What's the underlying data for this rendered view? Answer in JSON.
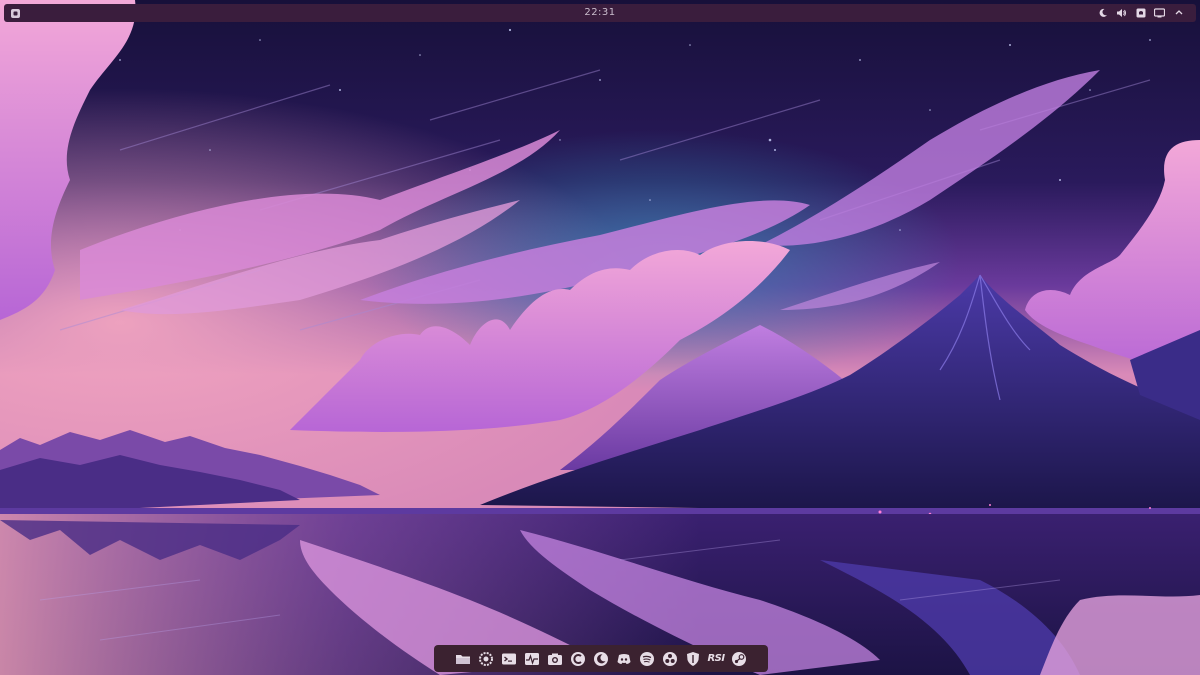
{
  "topbar": {
    "clock": "22:31",
    "tray_icons": [
      "night-light-icon",
      "volume-icon",
      "notifications-icon",
      "display-icon",
      "power-icon"
    ]
  },
  "dock": {
    "items": [
      {
        "name": "files-icon"
      },
      {
        "name": "settings-icon"
      },
      {
        "name": "terminal-icon"
      },
      {
        "name": "system-monitor-icon"
      },
      {
        "name": "screenshot-icon"
      },
      {
        "name": "app-c-icon"
      },
      {
        "name": "moon-app-icon"
      },
      {
        "name": "discord-icon"
      },
      {
        "name": "spotify-icon"
      },
      {
        "name": "obs-icon"
      },
      {
        "name": "shield-icon"
      },
      {
        "name": "rsi-icon",
        "label": "RSI"
      },
      {
        "name": "steam-icon"
      }
    ]
  },
  "colors": {
    "topbar_bg": "#3a1d3d",
    "dock_bg": "#3b2230",
    "icon": "#e7dde6"
  }
}
